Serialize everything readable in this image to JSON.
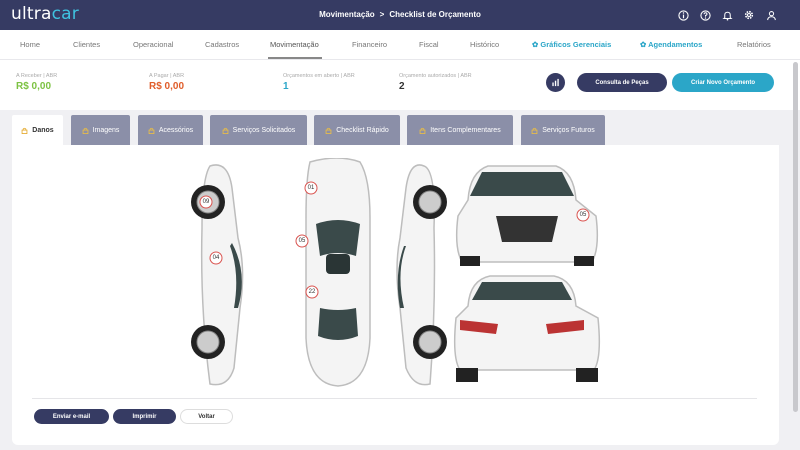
{
  "brand": {
    "prefix": "ultra",
    "suffix": "car"
  },
  "breadcrumb": {
    "section": "Movimentação",
    "separator": ">",
    "page": "Checklist de Orçamento"
  },
  "top_icons": [
    "info-icon",
    "help-icon",
    "bell-icon",
    "gear-icon",
    "user-icon"
  ],
  "nav": {
    "items": [
      "Home",
      "Clientes",
      "Operacional",
      "Cadastros",
      "Movimentação",
      "Financeiro",
      "Fiscal",
      "Histórico",
      "Gráficos Gerenciais",
      "Agendamentos",
      "Relatórios"
    ],
    "active": "Movimentação"
  },
  "stats": [
    {
      "label": "A Receber | ABR",
      "value": "R$ 0,00",
      "color": "#7cc242"
    },
    {
      "label": "A Pagar | ABR",
      "value": "R$ 0,00",
      "color": "#e05d2a"
    },
    {
      "label": "Orçamentos em aberto | ABR",
      "value": "1",
      "color": "#2ba6c8"
    },
    {
      "label": "Orçamento autorizados | ABR",
      "value": "2",
      "color": "#333333"
    }
  ],
  "actions": {
    "consulta": "Consulta de Peças",
    "criar": "Criar Novo Orçamento"
  },
  "tabs": [
    "Danos",
    "Imagens",
    "Acessórios",
    "Serviços Solicitados",
    "Checklist Rápido",
    "Itens Complementares",
    "Serviços Futuros"
  ],
  "damage_markers": [
    "09",
    "04",
    "01",
    "05",
    "22",
    "05"
  ],
  "footer_buttons": {
    "email": "Enviar e-mail",
    "print": "Imprimir",
    "back": "Voltar"
  },
  "colors": {
    "topbar": "#363b63",
    "accent": "#2ba6c8",
    "primary_button": "#363b63",
    "create_button": "#2ba6c8",
    "tab_inactive": "#8b8fa8"
  }
}
